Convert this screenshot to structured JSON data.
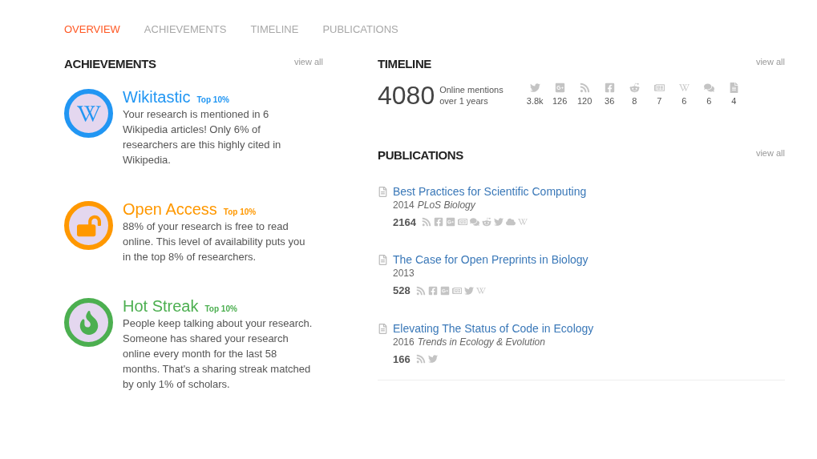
{
  "tabs": [
    {
      "label": "OVERVIEW",
      "selected": true
    },
    {
      "label": "ACHIEVEMENTS",
      "selected": false
    },
    {
      "label": "TIMELINE",
      "selected": false
    },
    {
      "label": "PUBLICATIONS",
      "selected": false
    }
  ],
  "achievements": {
    "title": "ACHIEVEMENTS",
    "view_all": "view all",
    "items": [
      {
        "kind": "wikipedia",
        "color": "#2196f3",
        "name": "Wikitastic",
        "badge": "Top 10%",
        "text": "Your research is mentioned in 6 Wikipedia articles! Only 6% of researchers are this highly cited in Wikipedia."
      },
      {
        "kind": "lock",
        "color": "#ff9800",
        "name": "Open Access",
        "badge": "Top 10%",
        "text": "88% of your research is free to read online. This level of availability puts you in the top 8% of researchers."
      },
      {
        "kind": "flame",
        "color": "#4caf50",
        "name": "Hot Streak",
        "badge": "Top 10%",
        "text": "People keep talking about your research. Someone has shared your research online every month for the last 58 months. That's a sharing streak matched by only 1% of scholars."
      }
    ]
  },
  "timeline": {
    "title": "TIMELINE",
    "view_all": "view all",
    "total": "4080",
    "caption_1": "Online mentions",
    "caption_2": "over 1 years",
    "sources": [
      {
        "kind": "twitter",
        "count": "3.8k"
      },
      {
        "kind": "gplus",
        "count": "126"
      },
      {
        "kind": "rss",
        "count": "120"
      },
      {
        "kind": "facebook",
        "count": "36"
      },
      {
        "kind": "reddit",
        "count": "8"
      },
      {
        "kind": "news",
        "count": "7"
      },
      {
        "kind": "wikipedia",
        "count": "6"
      },
      {
        "kind": "forum",
        "count": "6"
      },
      {
        "kind": "f1000",
        "count": "4"
      }
    ]
  },
  "publications": {
    "title": "PUBLICATIONS",
    "view_all": "view all",
    "items": [
      {
        "title": "Best Practices for Scientific Computing",
        "year": "2014",
        "venue": "PLoS Biology",
        "count": "2164",
        "sources": [
          {
            "kind": "rss"
          },
          {
            "kind": "facebook"
          },
          {
            "kind": "gplus"
          },
          {
            "kind": "news"
          },
          {
            "kind": "forum"
          },
          {
            "kind": "reddit"
          },
          {
            "kind": "twitter"
          },
          {
            "kind": "cloud"
          },
          {
            "kind": "wikipedia"
          }
        ]
      },
      {
        "title": "The Case for Open Preprints in Biology",
        "year": "2013",
        "count": "528",
        "sources": [
          {
            "kind": "rss"
          },
          {
            "kind": "facebook"
          },
          {
            "kind": "gplus"
          },
          {
            "kind": "news"
          },
          {
            "kind": "twitter"
          },
          {
            "kind": "wikipedia"
          }
        ]
      },
      {
        "title": "Elevating The Status of Code in Ecology",
        "year": "2016",
        "venue": "Trends in Ecology & Evolution",
        "count": "166",
        "sources": [
          {
            "kind": "rss"
          },
          {
            "kind": "twitter"
          }
        ]
      }
    ]
  }
}
